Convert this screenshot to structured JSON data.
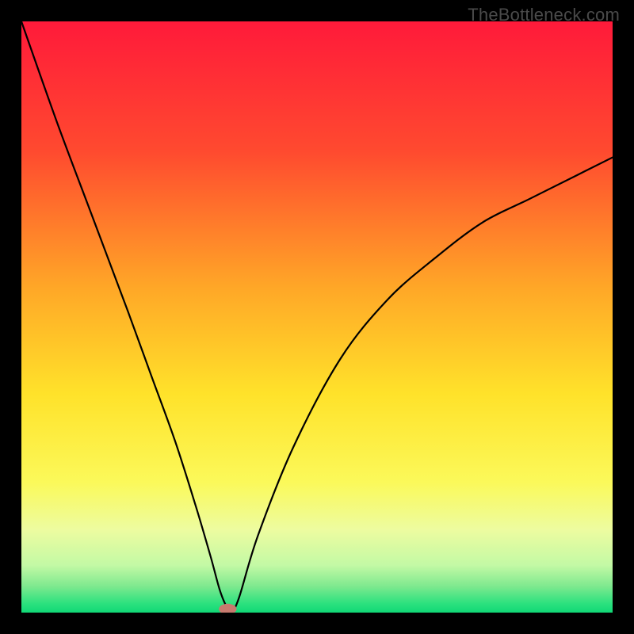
{
  "watermark": "TheBottleneck.com",
  "chart_data": {
    "type": "line",
    "title": "",
    "xlabel": "",
    "ylabel": "",
    "xlim": [
      0,
      100
    ],
    "ylim": [
      0,
      100
    ],
    "gradient_stops": [
      {
        "offset": 0,
        "color": "#ff1a3a"
      },
      {
        "offset": 0.22,
        "color": "#ff4a2f"
      },
      {
        "offset": 0.45,
        "color": "#ffa727"
      },
      {
        "offset": 0.63,
        "color": "#ffe22a"
      },
      {
        "offset": 0.78,
        "color": "#fbf95a"
      },
      {
        "offset": 0.86,
        "color": "#edfca0"
      },
      {
        "offset": 0.92,
        "color": "#c3f9a5"
      },
      {
        "offset": 0.955,
        "color": "#7fe98f"
      },
      {
        "offset": 0.985,
        "color": "#2be17e"
      },
      {
        "offset": 1.0,
        "color": "#11d876"
      }
    ],
    "series": [
      {
        "name": "bottleneck-curve",
        "x": [
          0,
          6,
          12,
          18,
          22,
          26,
          29.5,
          32,
          33.5,
          34.6,
          35.5,
          36.8,
          40,
          46,
          54,
          62,
          70,
          78,
          86,
          94,
          100
        ],
        "y": [
          100,
          83,
          67,
          51,
          40,
          29,
          18,
          9.5,
          4,
          1.2,
          0.1,
          2.5,
          13,
          28,
          43,
          53,
          60,
          66,
          70,
          74,
          77
        ]
      }
    ],
    "marker": {
      "x": 34.9,
      "y": 0.6,
      "color": "#c77a6e",
      "rx": 1.5,
      "ry": 0.9
    }
  }
}
